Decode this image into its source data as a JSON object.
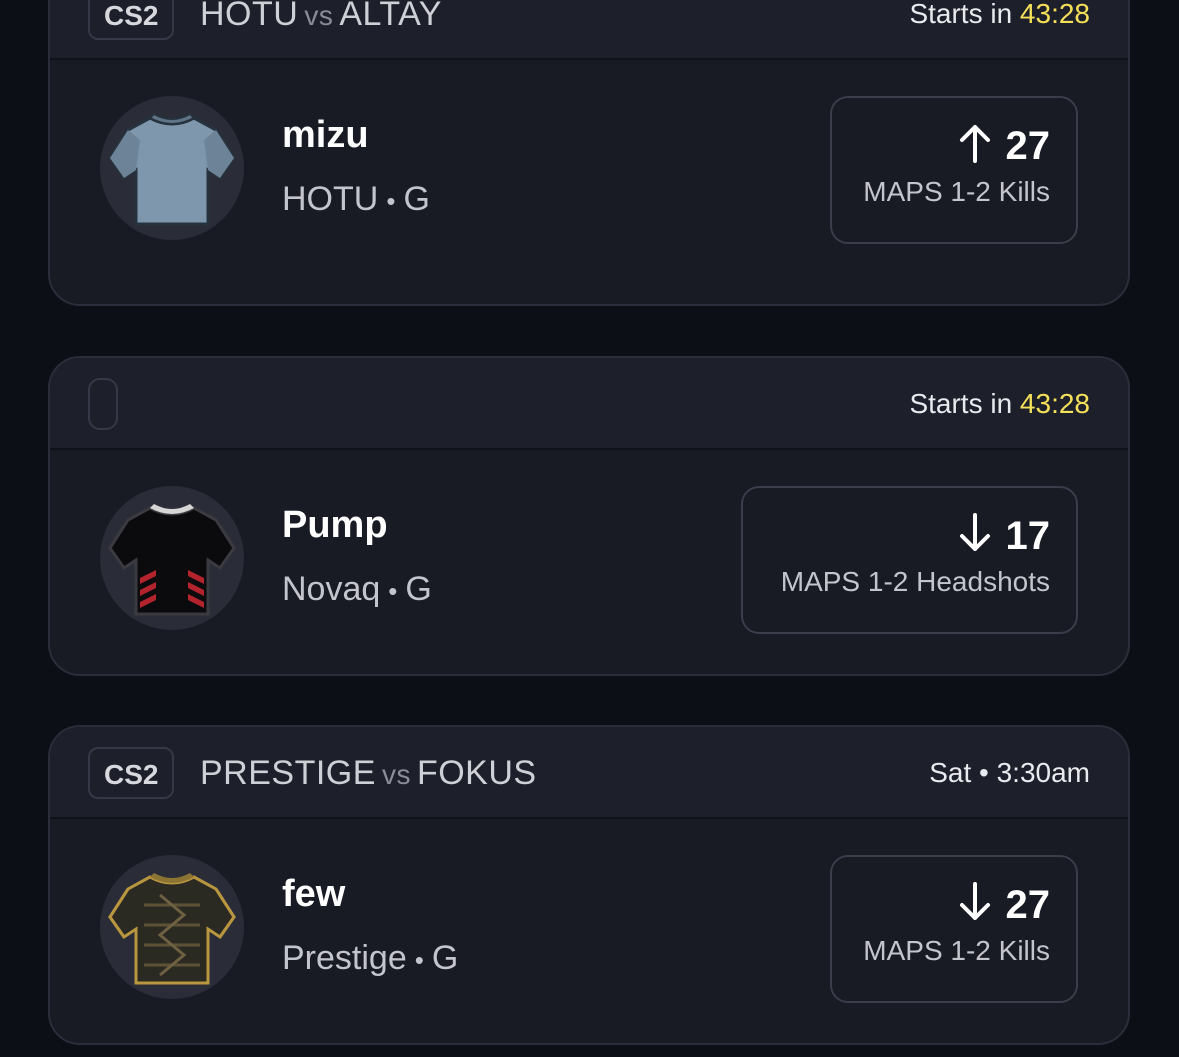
{
  "cards": [
    {
      "league": "CS2",
      "team_a": "HOTU",
      "vs": "vs",
      "team_b": "ALTAY",
      "starts_prefix": "Starts in",
      "starts_time": "43:28",
      "player": "mizu",
      "team": "HOTU",
      "meta_sep": "•",
      "position": "G",
      "direction": "up",
      "line": "27",
      "stat": "MAPS 1-2 Kills",
      "jersey_color": "#7f97ad"
    },
    {
      "league": "",
      "team_a": "",
      "vs": "",
      "team_b": "",
      "starts_prefix": "Starts in",
      "starts_time": "43:28",
      "player": "Pump",
      "team": "Novaq",
      "meta_sep": "•",
      "position": "G",
      "direction": "down",
      "line": "17",
      "stat": "MAPS 1-2 Headshots",
      "jersey_color": "#0b0b0d"
    },
    {
      "league": "CS2",
      "team_a": "PRESTIGE",
      "vs": "vs",
      "team_b": "FOKUS",
      "starts_prefix": "Sat • 3:30am",
      "starts_time": "",
      "player": "few",
      "team": "Prestige",
      "meta_sep": "•",
      "position": "G",
      "direction": "down",
      "line": "27",
      "stat": "MAPS 1-2 Kills",
      "jersey_color": "#2a2922"
    }
  ],
  "colors": {
    "background": "#0d0f17",
    "card": "#181a24",
    "timer": "#f5e05a"
  }
}
